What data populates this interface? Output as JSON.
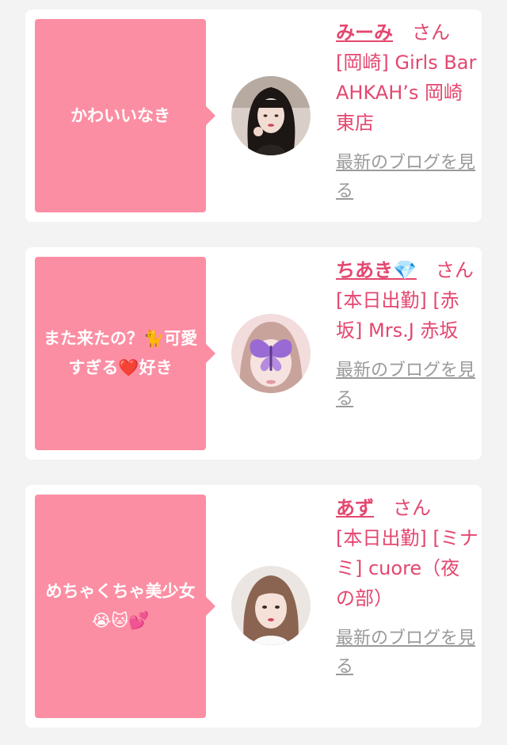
{
  "cards": [
    {
      "message": "かわいいなき",
      "name": "みーみ",
      "honorific": "さん",
      "store_line": "[岡崎] Girls Bar AHKAH’s 岡崎東店",
      "blog_link": "最新のブログを見る",
      "avatar_icon": "girl-photo-dark-hair"
    },
    {
      "message": "また来たの？🐈可愛すぎる❤️好き",
      "name": "ちあき💎",
      "honorific": "さん",
      "store_line": "[本日出勤] [赤坂] Mrs.J 赤坂",
      "blog_link": "最新のブログを見る",
      "avatar_icon": "girl-photo-butterfly-sticker"
    },
    {
      "message": "めちゃくちゃ美少女😭🐱💕",
      "name": "あず",
      "honorific": "さん",
      "store_line": "[本日出勤] [ミナミ] cuore（夜の部）",
      "blog_link": "最新のブログを見る",
      "avatar_icon": "girl-photo-light-hair"
    }
  ],
  "colors": {
    "bubble": "#fc8ea3",
    "accent_text": "#e4476f",
    "link_gray": "#9a9a9a",
    "background": "#f3f3f3"
  }
}
